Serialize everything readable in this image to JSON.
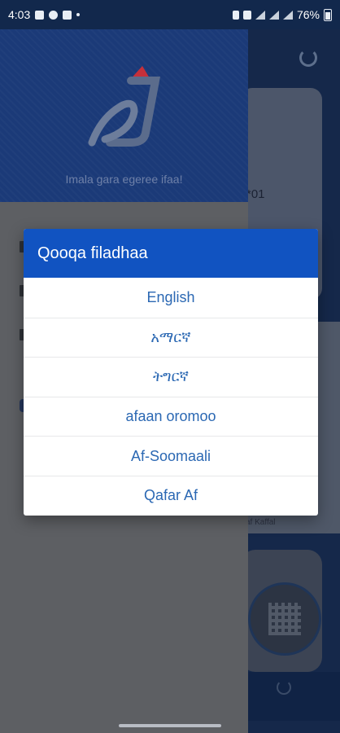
{
  "status_bar": {
    "time": "4:03",
    "battery": "76%"
  },
  "drawer": {
    "tagline": "Imala gara egeree ifaa!"
  },
  "background": {
    "card_fragment": "*01",
    "card2_fragment": "af Kaffal"
  },
  "dialog": {
    "title": "Qooqa filadhaa",
    "languages": [
      "English",
      "አማርኛ",
      "ትግርኛ",
      "afaan oromoo",
      "Af-Soomaali",
      "Qafar Af"
    ]
  },
  "colors": {
    "dialog_header": "#1153c1",
    "language_text": "#2b68b3",
    "drawer_header": "#1b3a78"
  }
}
